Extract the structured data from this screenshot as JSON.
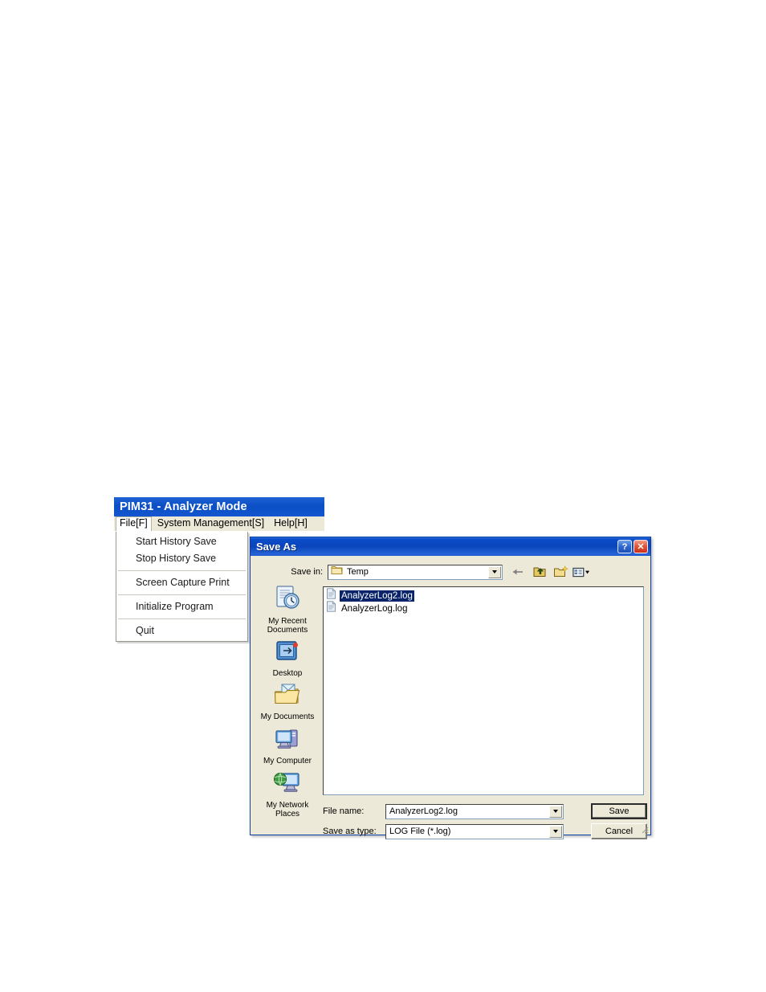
{
  "app_window": {
    "title": "PIM31 - Analyzer Mode",
    "menubar": [
      {
        "label": "File[F]",
        "active": true
      },
      {
        "label": "System Management[S]",
        "active": false
      },
      {
        "label": "Help[H]",
        "active": false
      }
    ],
    "file_menu": [
      {
        "label": "Start History Save",
        "separator_after": false
      },
      {
        "label": "Stop History Save",
        "separator_after": true
      },
      {
        "label": "Screen Capture  Print",
        "separator_after": true
      },
      {
        "label": "Initialize Program",
        "separator_after": true
      },
      {
        "label": "Quit",
        "separator_after": false
      }
    ]
  },
  "dialog": {
    "title": "Save As",
    "help_button": "?",
    "close_button": "✕",
    "save_in": {
      "label": "Save in:",
      "value": "Temp",
      "icon": "folder-icon"
    },
    "toolbar": [
      {
        "name": "back-icon",
        "tooltip": "Back"
      },
      {
        "name": "up-one-level-icon",
        "tooltip": "Up One Level"
      },
      {
        "name": "create-new-folder-icon",
        "tooltip": "Create New Folder"
      },
      {
        "name": "views-icon",
        "tooltip": "Views"
      }
    ],
    "places": [
      {
        "label": "My Recent Documents",
        "icon": "recent-documents-icon"
      },
      {
        "label": "Desktop",
        "icon": "desktop-icon"
      },
      {
        "label": "My Documents",
        "icon": "my-documents-icon"
      },
      {
        "label": "My Computer",
        "icon": "my-computer-icon"
      },
      {
        "label": "My Network Places",
        "icon": "network-places-icon"
      }
    ],
    "files": [
      {
        "name": "AnalyzerLog2.log",
        "selected": true,
        "icon": "log-file-icon"
      },
      {
        "name": "AnalyzerLog.log",
        "selected": false,
        "icon": "log-file-icon"
      }
    ],
    "file_name": {
      "label": "File name:",
      "value": "AnalyzerLog2.log"
    },
    "save_as_type": {
      "label": "Save as type:",
      "value": "LOG File (*.log)"
    },
    "buttons": {
      "save": "Save",
      "cancel": "Cancel"
    }
  },
  "colors": {
    "titlebar_blue": "#0a45bd",
    "dialog_face": "#ece9d8",
    "selection_blue": "#0a246a",
    "close_red": "#c8301a"
  }
}
